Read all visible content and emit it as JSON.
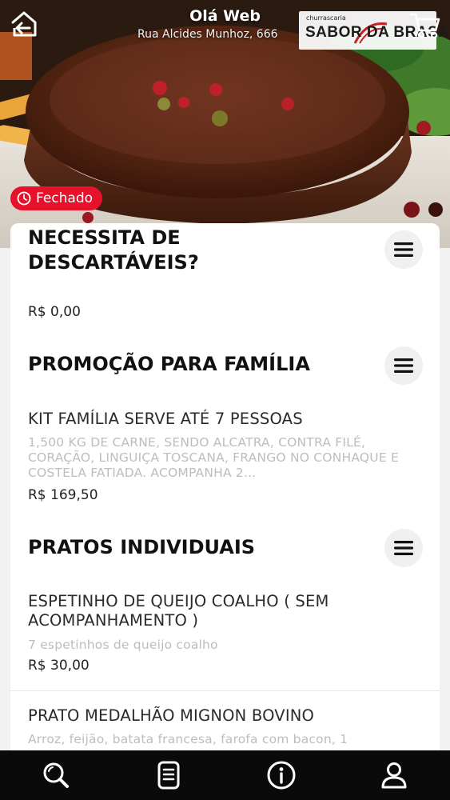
{
  "header": {
    "greeting": "Olá Web",
    "address": "Rua Alcides Munhoz, 666",
    "logo_small": "churrascaria",
    "logo_main": "SABOR DA BRASA"
  },
  "store": {
    "status": "Fechado"
  },
  "sections": [
    {
      "title_line1": "NECESSITA DE",
      "title_line2": "DESCARTÁVEIS?",
      "items": [
        {
          "price": "R$ 0,00"
        }
      ]
    },
    {
      "title": "PROMOÇÃO PARA FAMÍLIA",
      "items": [
        {
          "name": "KIT FAMÍLIA SERVE ATÉ 7 PESSOAS",
          "description": "1,500 KG DE CARNE, SENDO ALCATRA, CONTRA FILÉ, CORAÇÃO, LINGUIÇA TOSCANA, FRANGO NO CONHAQUE E COSTELA FATIADA. ACOMPANHA 2...",
          "price": "R$ 169,50"
        }
      ]
    },
    {
      "title": "PRATOS INDIVIDUAIS",
      "items": [
        {
          "name": "ESPETINHO DE QUEIJO COALHO ( SEM ACOMPANHAMENTO )",
          "description": "7 espetinhos de queijo coalho",
          "price": "R$ 30,00"
        },
        {
          "name": "PRATO MEDALHÃO MIGNON BOVINO",
          "description": "Arroz, feijão, batata francesa, farofa com bacon, 1"
        }
      ]
    }
  ],
  "colors": {
    "status_red": "#e8112b",
    "nav_background": "#0a0a0a",
    "icon_white": "#ffffff"
  },
  "icons": {
    "back": "back-home-icon",
    "cart": "cart-icon",
    "status": "clock-icon",
    "section_menu": "hamburger-icon",
    "nav": [
      "search-icon",
      "menu-icon",
      "info-icon",
      "user-icon"
    ]
  }
}
